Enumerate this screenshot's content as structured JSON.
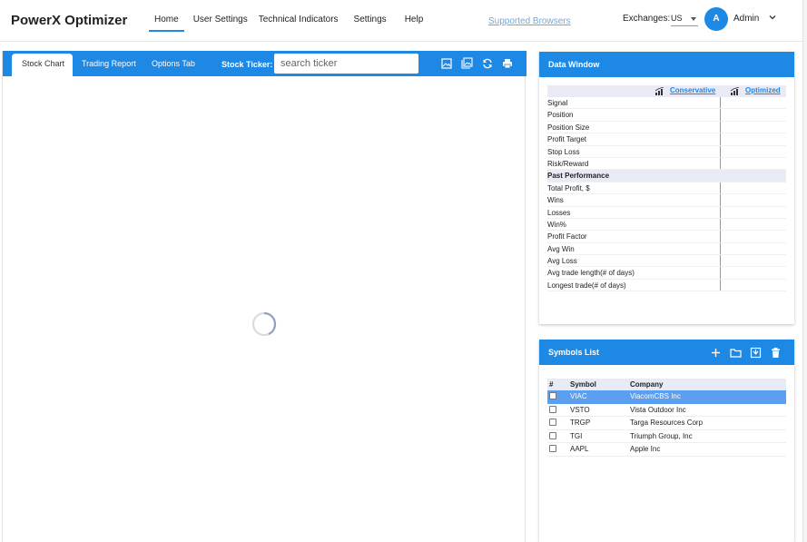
{
  "app": {
    "title": "PowerX Optimizer"
  },
  "nav": [
    {
      "label": "Home",
      "active": true
    },
    {
      "label": "User Settings"
    },
    {
      "label": "Technical Indicators"
    },
    {
      "label": "Settings"
    },
    {
      "label": "Help"
    }
  ],
  "header": {
    "supported_browsers": "Supported Browsers",
    "exchanges_label": "Exchanges:",
    "exchange_value": "US",
    "avatar_initial": "A",
    "username": "Admin"
  },
  "chart": {
    "tabs": [
      "Stock Chart",
      "Trading Report",
      "Options Tab"
    ],
    "ticker_label": "Stock Ticker:",
    "ticker_placeholder": "search ticker",
    "toolbar_icons": [
      "image-icon",
      "gallery-icon",
      "refresh-icon",
      "print-icon"
    ],
    "loading": true
  },
  "data_window": {
    "title": "Data Window",
    "col_conservative": "Conservative",
    "col_optimized": "Optimized",
    "rows": [
      {
        "label": "Signal"
      },
      {
        "label": "Position"
      },
      {
        "label": "Position Size"
      },
      {
        "label": "Profit Target"
      },
      {
        "label": "Stop Loss"
      },
      {
        "label": "Risk/Reward"
      },
      {
        "label": "Past Performance",
        "section": true
      },
      {
        "label": "Total Profit, $"
      },
      {
        "label": "Wins"
      },
      {
        "label": "Losses"
      },
      {
        "label": "Win%"
      },
      {
        "label": "Profit Factor"
      },
      {
        "label": "Avg Win"
      },
      {
        "label": "Avg Loss"
      },
      {
        "label": "Avg trade length(# of days)"
      },
      {
        "label": "Longest trade(# of days)"
      }
    ]
  },
  "symbols_list": {
    "title": "Symbols List",
    "icons": [
      "add-icon",
      "folder-icon",
      "download-icon",
      "trash-icon"
    ],
    "headers": {
      "hash": "#",
      "symbol": "Symbol",
      "company": "Company"
    },
    "rows": [
      {
        "symbol": "VIAC",
        "company": "ViacomCBS Inc",
        "selected": true
      },
      {
        "symbol": "VSTO",
        "company": "Vista Outdoor Inc"
      },
      {
        "symbol": "TRGP",
        "company": "Targa Resources Corp"
      },
      {
        "symbol": "TGI",
        "company": "Triumph Group, Inc"
      },
      {
        "symbol": "AAPL",
        "company": "Apple Inc"
      }
    ]
  },
  "colors": {
    "accent": "#1e88e5",
    "selected_row": "#5c9ef0",
    "table_header": "#e8eaf6"
  }
}
